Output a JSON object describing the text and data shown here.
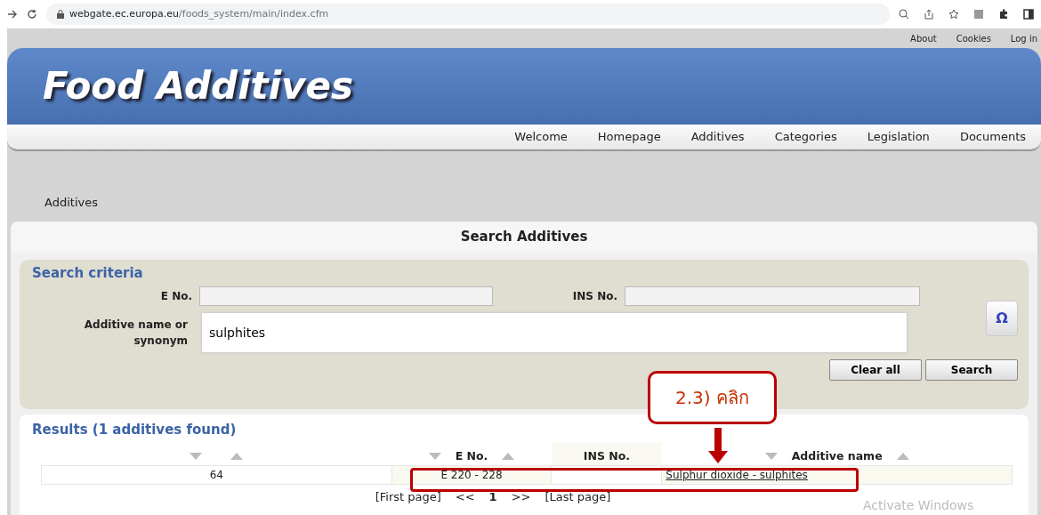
{
  "browser": {
    "url_host": "webgate.ec.europa.eu",
    "url_path": "/foods_system/main/index.cfm"
  },
  "top_links": [
    "About",
    "Cookies",
    "Log in"
  ],
  "site_title": "Food Additives",
  "nav": [
    {
      "label": "Welcome"
    },
    {
      "label": "Homepage"
    },
    {
      "label": "Additives"
    },
    {
      "label": "Categories"
    },
    {
      "label": "Legislation"
    },
    {
      "label": "Documents"
    }
  ],
  "breadcrumb": "Additives",
  "page_title": "Search Additives",
  "search": {
    "title": "Search criteria",
    "e_no_label": "E No.",
    "ins_no_label": "INS No.",
    "name_label": "Additive name or synonym",
    "name_value": "sulphites",
    "omega": "Ω",
    "buttons": [
      "Clear all",
      "Search"
    ]
  },
  "results": {
    "title": "Results (1 additives found)",
    "columns": [
      "",
      "E No.",
      "INS No.",
      "Additive name"
    ],
    "rows": [
      {
        "cells": [
          "64",
          "E 220 - 228",
          "",
          "Sulphur dioxide - sulphites"
        ]
      }
    ],
    "pager": {
      "first": "[First page]",
      "prev": "<<",
      "page": "1",
      "next": ">>",
      "last": "[Last page]"
    }
  },
  "callout": "2.3) คลิก",
  "os_watermark": "Activate Windows"
}
